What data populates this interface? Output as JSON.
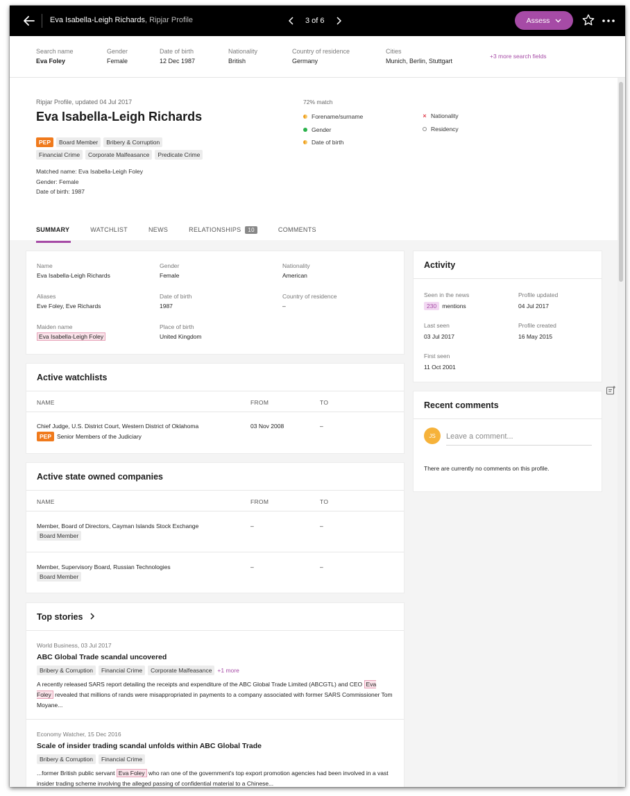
{
  "header": {
    "title_name": "Eva Isabella-Leigh Richards",
    "title_source": ", Ripjar Profile",
    "pager": "3 of 6",
    "assess_label": "Assess"
  },
  "search_fields": [
    {
      "label": "Search name",
      "value": "Eva Foley"
    },
    {
      "label": "Gender",
      "value": "Female"
    },
    {
      "label": "Date of birth",
      "value": "12 Dec 1987"
    },
    {
      "label": "Nationality",
      "value": "British"
    },
    {
      "label": "Country of residence",
      "value": "Germany"
    },
    {
      "label": "Cities",
      "value": "Munich, Berlin, Stuttgart"
    }
  ],
  "more_fields": "+3 more search fields",
  "profile": {
    "meta": "Ripjar Profile, updated 04 Jul 2017",
    "name": "Eva Isabella-Leigh Richards",
    "tags_row1": [
      "PEP",
      "Board Member",
      "Bribery & Corruption"
    ],
    "tags_row2": [
      "Financial Crime",
      "Corporate Malfeasance",
      "Predicate Crime"
    ],
    "matched_name": "Matched name: Eva Isabella-Leigh Foley",
    "matched_gender": "Gender: Female",
    "matched_dob": "Date of birth: 1987"
  },
  "match": {
    "percent": "72% match",
    "left": [
      {
        "label": "Forename/surname",
        "status": "partial"
      },
      {
        "label": "Gender",
        "status": "full"
      },
      {
        "label": "Date of birth",
        "status": "partial"
      }
    ],
    "right": [
      {
        "label": "Nationality",
        "status": "mismatch"
      },
      {
        "label": "Residency",
        "status": "none"
      }
    ]
  },
  "tabs": [
    {
      "label": "SUMMARY"
    },
    {
      "label": "WATCHLIST"
    },
    {
      "label": "NEWS"
    },
    {
      "label": "RELATIONSHIPS",
      "badge": "10"
    },
    {
      "label": "COMMENTS"
    }
  ],
  "details": {
    "name": {
      "label": "Name",
      "value": "Eva Isabella-Leigh Richards"
    },
    "gender": {
      "label": "Gender",
      "value": "Female"
    },
    "nationality": {
      "label": "Nationality",
      "value": "American"
    },
    "aliases": {
      "label": "Aliases",
      "value": "Eve Foley, Eve Richards"
    },
    "dob": {
      "label": "Date of birth",
      "value": "1987"
    },
    "residence": {
      "label": "Country of residence",
      "value": "–"
    },
    "maiden": {
      "label": "Maiden name",
      "value": "Eva Isabella-Leigh Foley"
    },
    "pob": {
      "label": "Place of birth",
      "value": "United Kingdom"
    }
  },
  "watchlists": {
    "title": "Active watchlists",
    "col_name": "NAME",
    "col_from": "FROM",
    "col_to": "TO",
    "rows": [
      {
        "name": "Chief Judge, U.S. District Court, Western District of Oklahoma",
        "tag": "PEP",
        "sub": "Senior Members of the Judiciary",
        "from": "03 Nov 2008",
        "to": "–"
      }
    ]
  },
  "companies": {
    "title": "Active state owned companies",
    "col_name": "NAME",
    "col_from": "FROM",
    "col_to": "TO",
    "rows": [
      {
        "name": "Member, Board of Directors, Cayman Islands Stock Exchange",
        "tag": "Board Member",
        "from": "–",
        "to": "–"
      },
      {
        "name": "Member, Supervisory Board, Russian Technologies",
        "tag": "Board Member",
        "from": "–",
        "to": "–"
      }
    ]
  },
  "stories": {
    "title": "Top stories",
    "items": [
      {
        "source": "World Business, 03 Jul 2017",
        "title": "ABC Global Trade scandal uncovered",
        "tags": [
          "Bribery & Corruption",
          "Financial Crime",
          "Corporate Malfeasance"
        ],
        "more": "+1 more",
        "body_a": "A recently released SARS report detailing the receipts and expenditure of the ABC Global Trade Limited (ABCGTL) and CEO ",
        "highlight": "Eva Foley",
        "body_b": " revealed that millions of rands were misappropriated in payments to a company associated with former SARS Commissioner Tom Moyane..."
      },
      {
        "source": "Economy Watcher, 15 Dec 2016",
        "title": "Scale of insider trading scandal unfolds within ABC Global Trade",
        "tags": [
          "Bribery & Corruption",
          "Financial Crime"
        ],
        "body_a": "...former British public servant ",
        "highlight": "Eva Foley",
        "body_b": " who ran one of the government's top export promotion agencies had been involved in a vast insider trading scheme involving the alleged passing of confidential material to a Chinese..."
      }
    ]
  },
  "activity": {
    "title": "Activity",
    "seen_label": "Seen in the news",
    "seen_count": "230",
    "seen_suffix": "mentions",
    "updated_label": "Profile updated",
    "updated_value": "04 Jul 2017",
    "last_label": "Last seen",
    "last_value": "03 Jul 2017",
    "created_label": "Profile created",
    "created_value": "16 May 2015",
    "first_label": "First seen",
    "first_value": "11 Oct 2001"
  },
  "comments": {
    "title": "Recent comments",
    "avatar_initials": "JS",
    "placeholder": "Leave a comment...",
    "empty": "There are currently no comments on this profile."
  },
  "colors": {
    "accent": "#a64ba6",
    "pep": "#f07a1c",
    "match_full": "#2bb24c",
    "match_partial": "#f0a020",
    "mismatch": "#e0414f"
  }
}
